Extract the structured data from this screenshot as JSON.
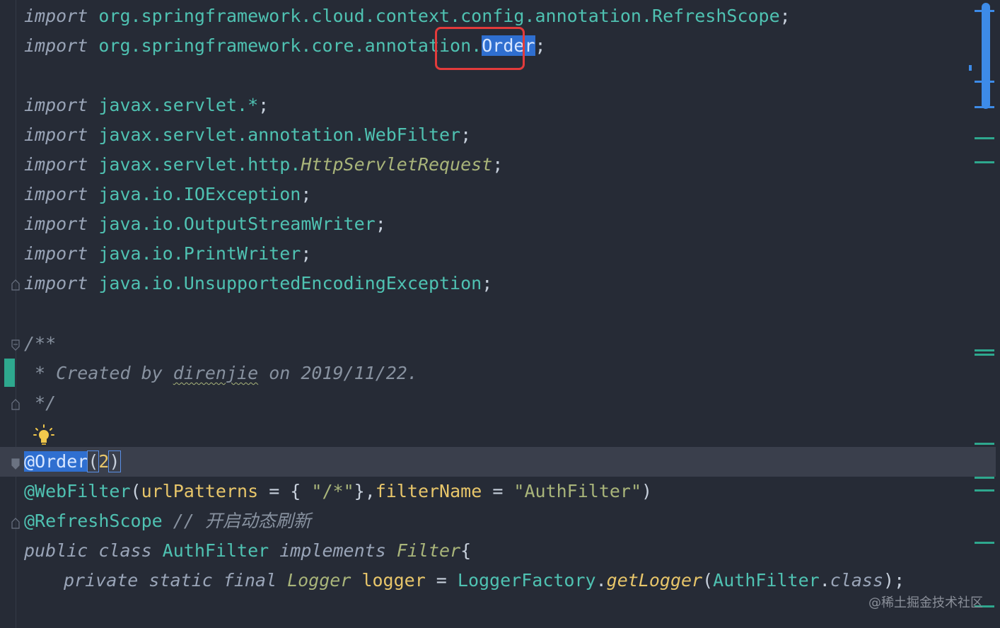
{
  "editor": {
    "lines": {
      "l1": {
        "kw": "import",
        "pkg": " org.springframework.cloud.context.config.annotation.RefreshScope",
        "end": ";"
      },
      "l2": {
        "kw": "import",
        "pkg": " org.springframework.core.annotation",
        "dot": ".",
        "sel": "Order",
        "end": ";"
      },
      "l3": {
        "kw": "import",
        "pkg": " javax.servlet.*",
        "end": ";"
      },
      "l4": {
        "kw": "import",
        "pkg": " javax.servlet.annotation.WebFilter",
        "end": ";"
      },
      "l5": {
        "kw": "import",
        "pkg": " javax.servlet.http.",
        "cls": "HttpServletRequest",
        "end": ";"
      },
      "l6": {
        "kw": "import",
        "pkg": " java.io.IOException",
        "end": ";"
      },
      "l7": {
        "kw": "import",
        "pkg": " java.io.OutputStreamWriter",
        "end": ";"
      },
      "l8": {
        "kw": "import",
        "pkg": " java.io.PrintWriter",
        "end": ";"
      },
      "l9": {
        "kw": "import",
        "pkg": " java.io.UnsupportedEncodingException",
        "end": ";"
      },
      "c1": "/**",
      "c2a": " * Created by ",
      "c2b": "direnjie",
      "c2c": " on 2019/11/22.",
      "c3": " */",
      "a1": {
        "at": "@",
        "name": "Order",
        "open": "(",
        "arg": "2",
        "close": ")"
      },
      "a2": {
        "ann": "@WebFilter",
        "p1": "(",
        "k1": "urlPatterns",
        "eq1": " = { ",
        "s1": "\"/*\"",
        "mid": "},",
        "k2": "filterName",
        "eq2": " = ",
        "s2": "\"AuthFilter\"",
        "close": ")"
      },
      "a3": {
        "ann": "@RefreshScope",
        "cmt": " // 开启动态刷新"
      },
      "d1": {
        "kw1": "public",
        "kw2": " class",
        "name": " AuthFilter",
        "kw3": " implements",
        "iface": " Filter",
        "brace": "{"
      },
      "d2": {
        "kw1": "private",
        "kw2": " static",
        "kw3": " final",
        "type": " Logger",
        "name": " logger",
        "eq": " = ",
        "cls": "LoggerFactory",
        "dot": ".",
        "method": "getLogger",
        "open": "(",
        "arg": "AuthFilter",
        "dot2": ".",
        "kwc": "class",
        "end": ");"
      }
    }
  },
  "watermark": "@稀土掘金技术社区",
  "colors": {
    "background": "#262b36",
    "selection": "#2f6fd0",
    "highlight_box": "#e23b3b",
    "scrollbar": "#3d8be8",
    "marker": "#2ea88e"
  },
  "icons": [
    "lightbulb-icon",
    "fold-icon"
  ]
}
